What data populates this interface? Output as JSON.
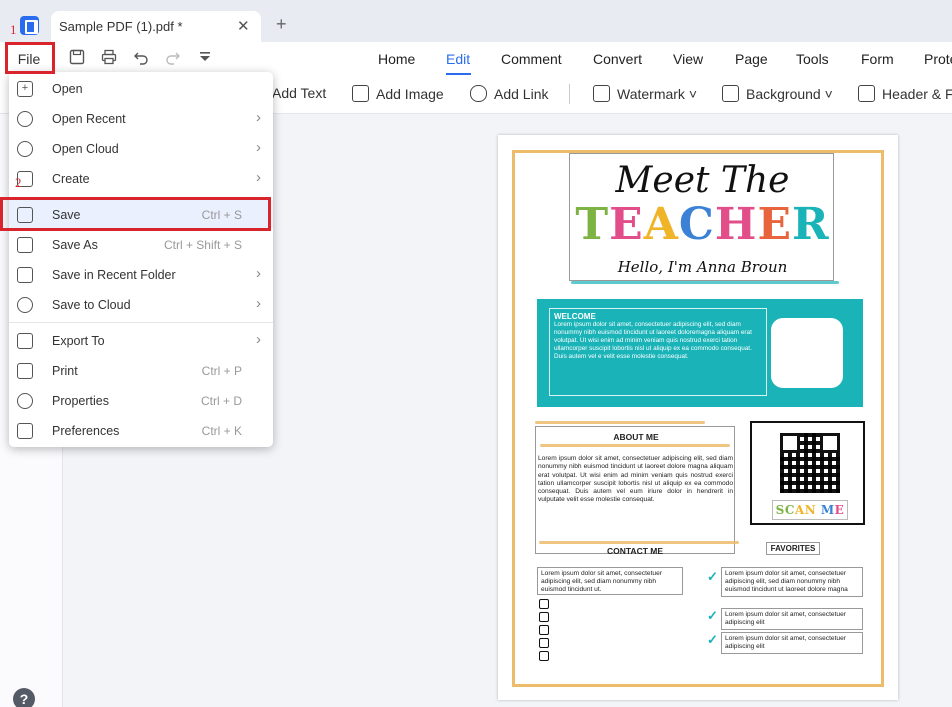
{
  "titlebar": {
    "tab_title": "Sample PDF (1).pdf *",
    "close_glyph": "✕",
    "new_tab_glyph": "+"
  },
  "toolbar": {
    "file_label": "File",
    "quick_icons": [
      "save-icon",
      "print-icon",
      "undo-icon",
      "redo-icon",
      "dropdown-icon"
    ],
    "menu_tabs": [
      "Home",
      "Edit",
      "Comment",
      "Convert",
      "View",
      "Page",
      "Tools",
      "Form",
      "Prote"
    ],
    "active_tab": "Edit"
  },
  "ribbon": {
    "add_text": "Add Text",
    "add_image": "Add Image",
    "add_link": "Add Link",
    "watermark": "Watermark",
    "background": "Background",
    "header_footer": "Header & F"
  },
  "file_menu": {
    "items": [
      {
        "label": "Open",
        "shortcut": "",
        "arrow": false,
        "icon": "open-icon"
      },
      {
        "label": "Open Recent",
        "shortcut": "",
        "arrow": true,
        "icon": "clock-icon"
      },
      {
        "label": "Open Cloud",
        "shortcut": "",
        "arrow": true,
        "icon": "cloud-icon"
      },
      {
        "label": "Create",
        "shortcut": "",
        "arrow": true,
        "icon": "create-icon"
      },
      {
        "label": "Save",
        "shortcut": "Ctrl + S",
        "arrow": false,
        "icon": "save-icon",
        "highlighted": true
      },
      {
        "label": "Save As",
        "shortcut": "Ctrl + Shift + S",
        "arrow": false,
        "icon": "save-as-icon"
      },
      {
        "label": "Save in Recent Folder",
        "shortcut": "",
        "arrow": true,
        "icon": "folder-icon"
      },
      {
        "label": "Save to Cloud",
        "shortcut": "",
        "arrow": true,
        "icon": "cloud-upload-icon"
      },
      {
        "label": "Export To",
        "shortcut": "",
        "arrow": true,
        "icon": "export-icon"
      },
      {
        "label": "Print",
        "shortcut": "Ctrl + P",
        "arrow": false,
        "icon": "print-icon"
      },
      {
        "label": "Properties",
        "shortcut": "Ctrl + D",
        "arrow": false,
        "icon": "properties-icon"
      },
      {
        "label": "Preferences",
        "shortcut": "Ctrl + K",
        "arrow": false,
        "icon": "preferences-icon"
      }
    ]
  },
  "annotations": {
    "step1": "1",
    "step2": "2",
    "color": "#d9232d"
  },
  "document": {
    "script_title": "Meet The",
    "big_title": "TEACHER",
    "subtitle": "Hello, I'm Anna Broun",
    "welcome_title": "WELCOME",
    "welcome_text": "Lorem ipsum dolor sit amet, consectetuer adipiscing elit, sed diam nonummy nibh euismod tincidunt ut laoreet doloremagna aliquam erat volutpat. Ut wisi enim ad minim veniam quis nostrud exerci tation ullamcorper suscipit lobortis nisl ut aliquip ex ea commodo consequat. Duis autem vel e velit esse molestie consequat.",
    "about_title": "ABOUT ME",
    "about_text": "Lorem ipsum dolor sit amet, consectetuer adipiscing elit, sed diam nonummy nibh euismod tincidunt ut laoreet dolore magna aliquam erat volutpat. Ut wisi enim ad minim veniam quis nostrud exerci tation ullamcorper suscipit lobortis nisl ut aliquip ex ea commodo consequat. Duis autem vel eum iriure dolor in hendrerit in vulputate velit esse molestie consequat.",
    "contact_title": "CONTACT ME",
    "contact_text": "Lorem ipsum dolor sit amet, consectetuer adipiscing elit, sed diam nonummy nibh euismod tincidunt ut.",
    "scan_label": "SCAN ME",
    "favorites_title": "FAVORITES",
    "favorites": [
      "Lorem ipsum dolor sit amet, consectetuer adipiscing elit, sed diam nonummy nibh euismod tincidunt ut laoreet dolore magna",
      "Lorem ipsum dolor sit amet, consectetuer adipiscing elit",
      "Lorem ipsum dolor sit amet, consectetuer adipiscing elit"
    ]
  },
  "help": {
    "glyph": "?"
  },
  "colors": {
    "accent": "#2a6cf0",
    "teal": "#1ab3b8",
    "gold": "#ecbc6b",
    "annotation_red": "#d9232d"
  }
}
